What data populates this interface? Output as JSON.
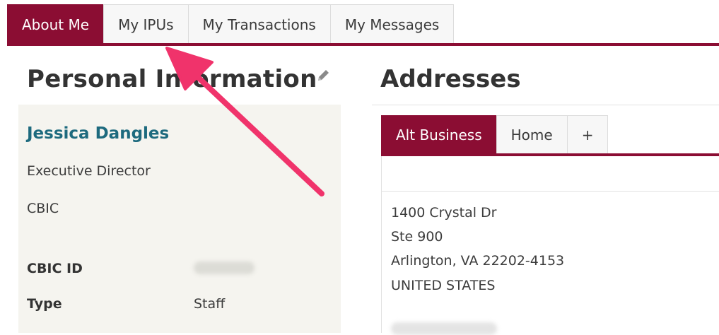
{
  "tabs": [
    {
      "label": "About Me",
      "active": true
    },
    {
      "label": "My IPUs",
      "active": false
    },
    {
      "label": "My Transactions",
      "active": false
    },
    {
      "label": "My Messages",
      "active": false
    }
  ],
  "personal_info": {
    "title": "Personal Information",
    "name": "Jessica Dangles",
    "job_title": "Executive Director",
    "organization": "CBIC",
    "fields": [
      {
        "label": "CBIC ID",
        "value": ""
      },
      {
        "label": "Type",
        "value": "Staff"
      }
    ]
  },
  "addresses": {
    "title": "Addresses",
    "tabs": [
      {
        "label": "Alt Business",
        "active": true
      },
      {
        "label": "Home",
        "active": false
      },
      {
        "label": "+",
        "active": false
      }
    ],
    "lines": [
      "1400 Crystal Dr",
      "Ste 900",
      "Arlington, VA 22202-4153",
      "UNITED STATES"
    ]
  },
  "colors": {
    "brand": "#8b0d33",
    "name_link": "#1d6a7e",
    "panel_bg": "#f5f4ef",
    "annotation_arrow": "#f0336b"
  },
  "icons": {
    "edit": "pencil-icon"
  }
}
